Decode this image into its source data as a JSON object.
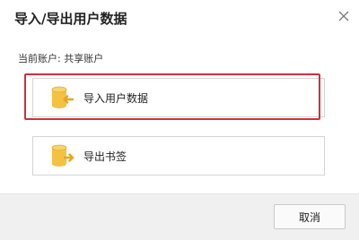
{
  "dialog": {
    "title": "导入/导出用户数据",
    "close_icon": "close-icon"
  },
  "account": {
    "text": "当前账户: 共享账户"
  },
  "options": [
    {
      "label": "导入用户数据",
      "icon": "database-import-icon",
      "selected": true,
      "highlight_color": "#d0303c"
    },
    {
      "label": "导出书签",
      "icon": "database-export-icon",
      "selected": false
    }
  ],
  "footer": {
    "cancel_label": "取消"
  },
  "colors": {
    "icon_yellow": "#f3c243",
    "arrow_orange": "#e8a41c",
    "selection_red": "#d0303c",
    "footer_bg": "#f0f0f0"
  }
}
